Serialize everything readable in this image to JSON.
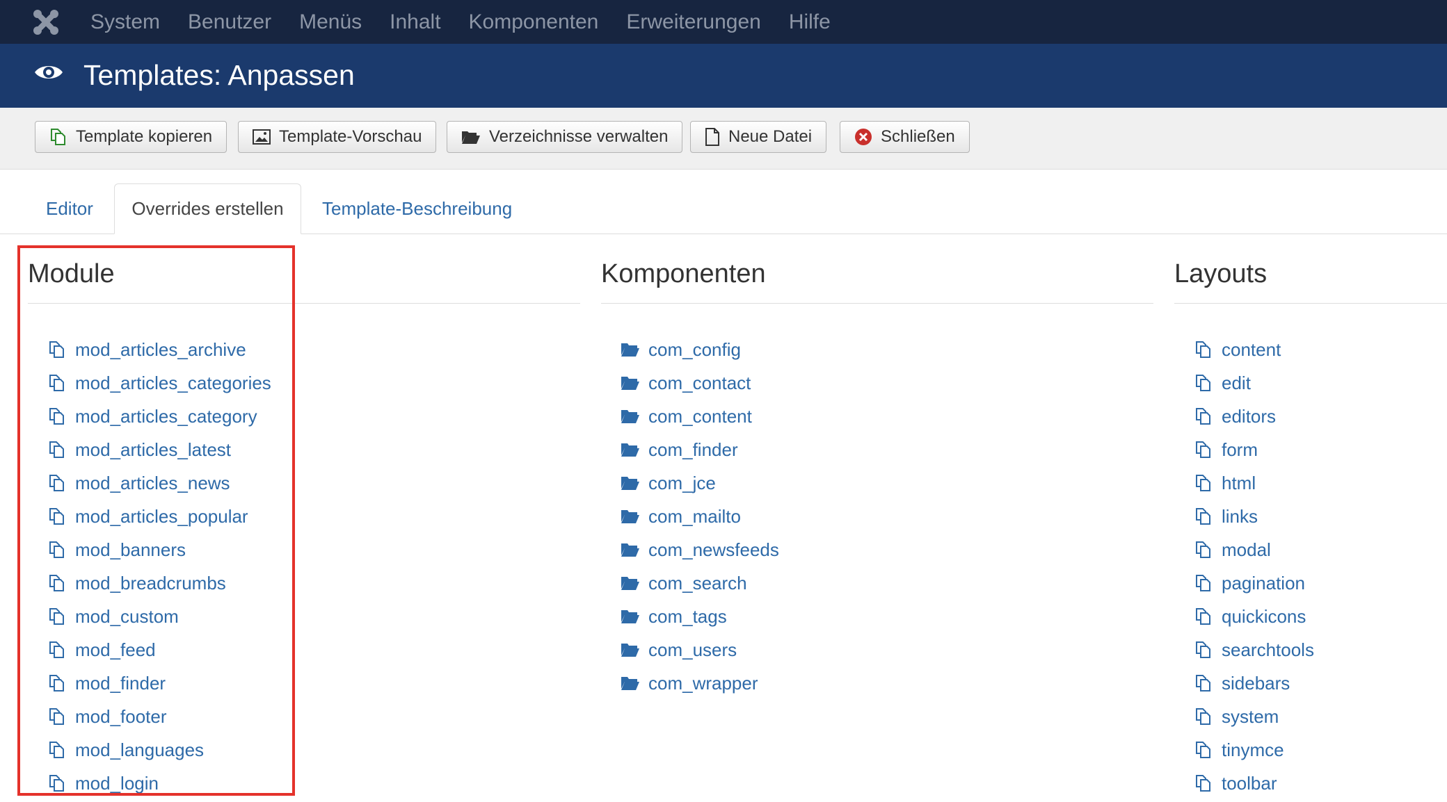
{
  "topnav": {
    "logo_icon": "joomla-logo-icon",
    "items": [
      "System",
      "Benutzer",
      "Menüs",
      "Inhalt",
      "Komponenten",
      "Erweiterungen",
      "Hilfe"
    ]
  },
  "header": {
    "icon": "eye-icon",
    "title": "Templates: Anpassen"
  },
  "toolbar": {
    "copy_label": "Template kopieren",
    "preview_label": "Template-Vorschau",
    "folders_label": "Verzeichnisse verwalten",
    "newfile_label": "Neue Datei",
    "close_label": "Schließen"
  },
  "tabs": [
    "Editor",
    "Overrides erstellen",
    "Template-Beschreibung"
  ],
  "active_tab": "Overrides erstellen",
  "columns": {
    "modules": {
      "title": "Module",
      "items": [
        "mod_articles_archive",
        "mod_articles_categories",
        "mod_articles_category",
        "mod_articles_latest",
        "mod_articles_news",
        "mod_articles_popular",
        "mod_banners",
        "mod_breadcrumbs",
        "mod_custom",
        "mod_feed",
        "mod_finder",
        "mod_footer",
        "mod_languages",
        "mod_login"
      ]
    },
    "components": {
      "title": "Komponenten",
      "items": [
        "com_config",
        "com_contact",
        "com_content",
        "com_finder",
        "com_jce",
        "com_mailto",
        "com_newsfeeds",
        "com_search",
        "com_tags",
        "com_users",
        "com_wrapper"
      ]
    },
    "layouts": {
      "title": "Layouts",
      "items": [
        "content",
        "edit",
        "editors",
        "form",
        "html",
        "links",
        "modal",
        "pagination",
        "quickicons",
        "searchtools",
        "sidebars",
        "system",
        "tinymce",
        "toolbar"
      ]
    }
  },
  "colors": {
    "topnav_bg": "#172540",
    "header_bg": "#1b3a6d",
    "link": "#2e6aa8",
    "highlight": "#e4322b",
    "close_icon": "#c9302c"
  }
}
